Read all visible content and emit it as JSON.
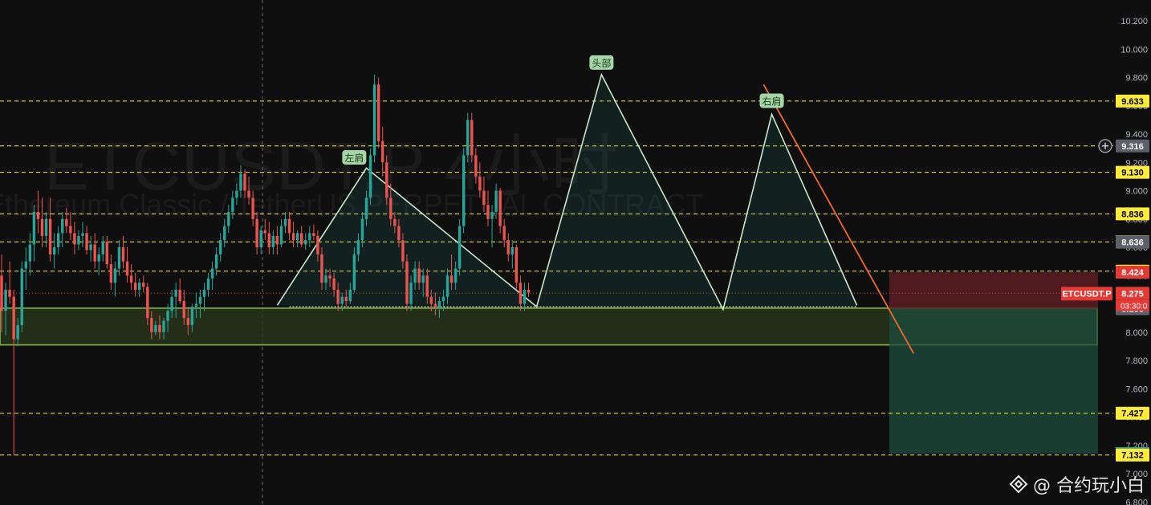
{
  "watermark": {
    "title": "ETCUSDT.P 4小时",
    "subtitle": "Ethereum Classic / TetherUS PERPETUAL CONTRACT"
  },
  "brand": {
    "handle": "@ 合约玩小白",
    "icon": "binance-square-icon"
  },
  "colors": {
    "background": "#0f0f0f",
    "up": "#26a69a",
    "down": "#ef5350",
    "pattern": "#c8e6c9",
    "trendline": "#f06a2a",
    "level_line": "#ffeb3b",
    "label_bg": "#ffeb3b",
    "price_tag": "#e53935",
    "target_zone": "#1e4d3c",
    "stop_zone": "#5a1d22",
    "support_zone": "#2b3a1e"
  },
  "chart_data": {
    "type": "candlestick",
    "symbol": "ETCUSDT.P",
    "interval": "4小时",
    "ylim": [
      6.8,
      10.35
    ],
    "y_ticks": [
      "10.200",
      "10.000",
      "9.800",
      "9.600",
      "9.400",
      "9.200",
      "9.000",
      "8.800",
      "8.600",
      "8.400",
      "8.200",
      "8.000",
      "7.800",
      "7.600",
      "7.400",
      "7.200",
      "7.000",
      "6.800"
    ],
    "horizontal_levels": [
      {
        "price": 9.633,
        "label": "9.633"
      },
      {
        "price": 9.316,
        "label": "9.316"
      },
      {
        "price": 9.13,
        "label": "9.130"
      },
      {
        "price": 8.836,
        "label": "8.836"
      },
      {
        "price": 8.638,
        "label": "8.638"
      },
      {
        "price": 8.431,
        "label": "8.431"
      },
      {
        "price": 7.427,
        "label": "7.427"
      },
      {
        "price": 7.132,
        "label": "7.132"
      }
    ],
    "axis_tags": [
      {
        "price": 9.633,
        "label": "9.633",
        "style": "yellow"
      },
      {
        "price": 9.316,
        "label": "9.316",
        "style": "gray"
      },
      {
        "price": 9.13,
        "label": "9.130",
        "style": "yellow"
      },
      {
        "price": 8.836,
        "label": "8.836",
        "style": "yellow"
      },
      {
        "price": 8.638,
        "label": "8.638",
        "style": "yellow"
      },
      {
        "price": 8.636,
        "label": "8.636",
        "style": "gray"
      },
      {
        "price": 8.431,
        "label": "8.431",
        "style": "yellow"
      },
      {
        "price": 8.424,
        "label": "8.424",
        "style": "red"
      },
      {
        "price": 8.275,
        "label": "8.275",
        "style": "red"
      },
      {
        "price": 8.166,
        "label": "8.166",
        "style": "gray"
      },
      {
        "price": 7.427,
        "label": "7.427",
        "style": "yellow"
      },
      {
        "price": 7.142,
        "label": "7.142",
        "style": "teal"
      },
      {
        "price": 7.132,
        "label": "7.132",
        "style": "yellow"
      }
    ],
    "current_price": {
      "symbol_label": "ETCUSDT.P",
      "price": "8.275",
      "countdown": "03:30:0"
    },
    "pattern_labels": [
      {
        "text": "左肩",
        "price": 9.23,
        "index": 87
      },
      {
        "text": "头部",
        "price": 9.9,
        "index": 148
      },
      {
        "text": "右肩",
        "price": 9.63,
        "index": 190
      }
    ],
    "head_shoulders": [
      [
        68,
        8.19
      ],
      [
        90,
        9.16
      ],
      [
        132,
        8.18
      ],
      [
        148,
        9.82
      ],
      [
        178,
        8.16
      ],
      [
        190,
        9.54
      ],
      [
        211,
        8.19
      ]
    ],
    "neckline": {
      "price": 8.18,
      "from_index": 71,
      "to_index": 211
    },
    "trendline": {
      "from": [
        188,
        9.75
      ],
      "to": [
        225,
        7.85
      ]
    },
    "support_zone": {
      "top": 8.17,
      "bottom": 7.91
    },
    "position": {
      "entry": 8.166,
      "stop": 8.424,
      "target": 7.142,
      "from_index": 219,
      "to_index": 272
    },
    "candles": [
      [
        8.4,
        8.55,
        8.0,
        8.15
      ],
      [
        8.15,
        8.35,
        7.98,
        8.3
      ],
      [
        8.3,
        8.5,
        8.2,
        8.25
      ],
      [
        8.25,
        8.3,
        7.13,
        7.95
      ],
      [
        7.95,
        8.1,
        7.9,
        8.05
      ],
      [
        8.05,
        8.5,
        8.0,
        8.45
      ],
      [
        8.45,
        8.6,
        8.3,
        8.5
      ],
      [
        8.5,
        8.7,
        8.4,
        8.62
      ],
      [
        8.62,
        8.9,
        8.5,
        8.85
      ],
      [
        8.85,
        9.0,
        8.7,
        8.8
      ],
      [
        8.8,
        8.95,
        8.6,
        8.68
      ],
      [
        8.68,
        8.85,
        8.6,
        8.8
      ],
      [
        8.8,
        8.95,
        8.5,
        8.55
      ],
      [
        8.55,
        8.7,
        8.45,
        8.6
      ],
      [
        8.6,
        8.75,
        8.55,
        8.7
      ],
      [
        8.7,
        8.85,
        8.6,
        8.8
      ],
      [
        8.8,
        8.88,
        8.7,
        8.75
      ],
      [
        8.75,
        8.85,
        8.65,
        8.7
      ],
      [
        8.7,
        8.78,
        8.55,
        8.62
      ],
      [
        8.62,
        8.72,
        8.58,
        8.68
      ],
      [
        8.68,
        8.78,
        8.6,
        8.7
      ],
      [
        8.7,
        8.75,
        8.55,
        8.58
      ],
      [
        8.58,
        8.68,
        8.5,
        8.62
      ],
      [
        8.62,
        8.7,
        8.45,
        8.5
      ],
      [
        8.5,
        8.6,
        8.4,
        8.55
      ],
      [
        8.55,
        8.68,
        8.5,
        8.64
      ],
      [
        8.64,
        8.68,
        8.45,
        8.48
      ],
      [
        8.48,
        8.55,
        8.3,
        8.35
      ],
      [
        8.35,
        8.5,
        8.25,
        8.45
      ],
      [
        8.45,
        8.65,
        8.4,
        8.6
      ],
      [
        8.6,
        8.68,
        8.45,
        8.5
      ],
      [
        8.5,
        8.6,
        8.35,
        8.4
      ],
      [
        8.4,
        8.48,
        8.3,
        8.35
      ],
      [
        8.35,
        8.42,
        8.25,
        8.3
      ],
      [
        8.3,
        8.38,
        8.25,
        8.35
      ],
      [
        8.35,
        8.4,
        8.28,
        8.32
      ],
      [
        8.32,
        8.35,
        8.05,
        8.1
      ],
      [
        8.1,
        8.15,
        7.95,
        8.0
      ],
      [
        8.0,
        8.08,
        7.98,
        8.05
      ],
      [
        8.05,
        8.12,
        7.95,
        8.0
      ],
      [
        8.0,
        8.1,
        7.95,
        8.08
      ],
      [
        8.08,
        8.2,
        8.0,
        8.15
      ],
      [
        8.15,
        8.3,
        8.1,
        8.25
      ],
      [
        8.25,
        8.35,
        8.1,
        8.3
      ],
      [
        8.3,
        8.38,
        8.2,
        8.22
      ],
      [
        8.22,
        8.3,
        8.05,
        8.1
      ],
      [
        8.1,
        8.18,
        7.98,
        8.05
      ],
      [
        8.05,
        8.2,
        8.0,
        8.18
      ],
      [
        8.18,
        8.28,
        8.1,
        8.2
      ],
      [
        8.2,
        8.3,
        8.1,
        8.25
      ],
      [
        8.25,
        8.35,
        8.15,
        8.3
      ],
      [
        8.3,
        8.42,
        8.25,
        8.38
      ],
      [
        8.38,
        8.5,
        8.3,
        8.45
      ],
      [
        8.45,
        8.6,
        8.4,
        8.55
      ],
      [
        8.55,
        8.7,
        8.5,
        8.65
      ],
      [
        8.65,
        8.8,
        8.6,
        8.75
      ],
      [
        8.75,
        8.9,
        8.7,
        8.85
      ],
      [
        8.85,
        9.0,
        8.8,
        8.95
      ],
      [
        8.95,
        9.05,
        8.9,
        9.0
      ],
      [
        9.0,
        9.18,
        8.95,
        9.12
      ],
      [
        9.12,
        9.15,
        8.95,
        9.0
      ],
      [
        9.0,
        9.1,
        8.9,
        8.95
      ],
      [
        8.95,
        9.0,
        8.75,
        8.8
      ],
      [
        8.8,
        8.85,
        8.55,
        8.6
      ],
      [
        8.6,
        8.75,
        8.55,
        8.72
      ],
      [
        8.72,
        8.8,
        8.65,
        8.7
      ],
      [
        8.7,
        8.78,
        8.55,
        8.6
      ],
      [
        8.6,
        8.72,
        8.55,
        8.68
      ],
      [
        8.68,
        8.75,
        8.55,
        8.62
      ],
      [
        8.62,
        8.8,
        8.6,
        8.75
      ],
      [
        8.75,
        8.85,
        8.7,
        8.8
      ],
      [
        8.8,
        8.85,
        8.65,
        8.7
      ],
      [
        8.7,
        8.78,
        8.6,
        8.65
      ],
      [
        8.65,
        8.72,
        8.6,
        8.7
      ],
      [
        8.7,
        8.75,
        8.6,
        8.62
      ],
      [
        8.62,
        8.7,
        8.58,
        8.65
      ],
      [
        8.65,
        8.75,
        8.6,
        8.7
      ],
      [
        8.7,
        8.76,
        8.65,
        8.68
      ],
      [
        8.68,
        8.72,
        8.5,
        8.55
      ],
      [
        8.55,
        8.6,
        8.3,
        8.35
      ],
      [
        8.35,
        8.45,
        8.3,
        8.4
      ],
      [
        8.4,
        8.45,
        8.32,
        8.38
      ],
      [
        8.38,
        8.42,
        8.25,
        8.3
      ],
      [
        8.3,
        8.35,
        8.15,
        8.2
      ],
      [
        8.2,
        8.28,
        8.15,
        8.25
      ],
      [
        8.25,
        8.3,
        8.18,
        8.22
      ],
      [
        8.22,
        8.35,
        8.2,
        8.3
      ],
      [
        8.3,
        8.6,
        8.28,
        8.55
      ],
      [
        8.55,
        8.7,
        8.5,
        8.65
      ],
      [
        8.65,
        8.85,
        8.6,
        8.8
      ],
      [
        8.8,
        9.0,
        8.75,
        8.95
      ],
      [
        8.95,
        9.3,
        8.9,
        9.25
      ],
      [
        9.25,
        9.82,
        9.2,
        9.75
      ],
      [
        9.75,
        9.8,
        9.3,
        9.35
      ],
      [
        9.35,
        9.45,
        9.1,
        9.2
      ],
      [
        9.2,
        9.25,
        8.9,
        8.95
      ],
      [
        8.95,
        9.05,
        8.75,
        8.8
      ],
      [
        8.8,
        8.85,
        8.7,
        8.75
      ],
      [
        8.75,
        8.8,
        8.6,
        8.65
      ],
      [
        8.65,
        8.7,
        8.45,
        8.5
      ],
      [
        8.5,
        8.55,
        8.15,
        8.2
      ],
      [
        8.2,
        8.4,
        8.15,
        8.35
      ],
      [
        8.35,
        8.5,
        8.3,
        8.45
      ],
      [
        8.45,
        8.5,
        8.3,
        8.35
      ],
      [
        8.35,
        8.45,
        8.25,
        8.4
      ],
      [
        8.4,
        8.45,
        8.2,
        8.25
      ],
      [
        8.25,
        8.3,
        8.15,
        8.2
      ],
      [
        8.2,
        8.28,
        8.12,
        8.18
      ],
      [
        8.18,
        8.25,
        8.1,
        8.22
      ],
      [
        8.22,
        8.3,
        8.15,
        8.25
      ],
      [
        8.25,
        8.45,
        8.2,
        8.4
      ],
      [
        8.4,
        8.55,
        8.3,
        8.35
      ],
      [
        8.35,
        8.5,
        8.3,
        8.45
      ],
      [
        8.45,
        8.8,
        8.4,
        8.75
      ],
      [
        8.75,
        9.3,
        8.7,
        9.25
      ],
      [
        9.25,
        9.55,
        9.2,
        9.5
      ],
      [
        9.5,
        9.55,
        9.2,
        9.25
      ],
      [
        9.25,
        9.3,
        9.05,
        9.1
      ],
      [
        9.1,
        9.2,
        8.95,
        9.0
      ],
      [
        9.0,
        9.1,
        8.85,
        8.9
      ],
      [
        8.9,
        9.0,
        8.75,
        8.8
      ],
      [
        8.8,
        8.9,
        8.6,
        8.85
      ],
      [
        8.85,
        9.05,
        8.8,
        9.0
      ],
      [
        9.0,
        9.02,
        8.7,
        8.75
      ],
      [
        8.75,
        8.8,
        8.6,
        8.65
      ],
      [
        8.65,
        8.7,
        8.5,
        8.55
      ],
      [
        8.55,
        8.65,
        8.45,
        8.6
      ],
      [
        8.6,
        8.62,
        8.3,
        8.35
      ],
      [
        8.35,
        8.4,
        8.15,
        8.2
      ],
      [
        8.2,
        8.35,
        8.15,
        8.3
      ],
      [
        8.3,
        8.35,
        8.25,
        8.28
      ]
    ]
  }
}
